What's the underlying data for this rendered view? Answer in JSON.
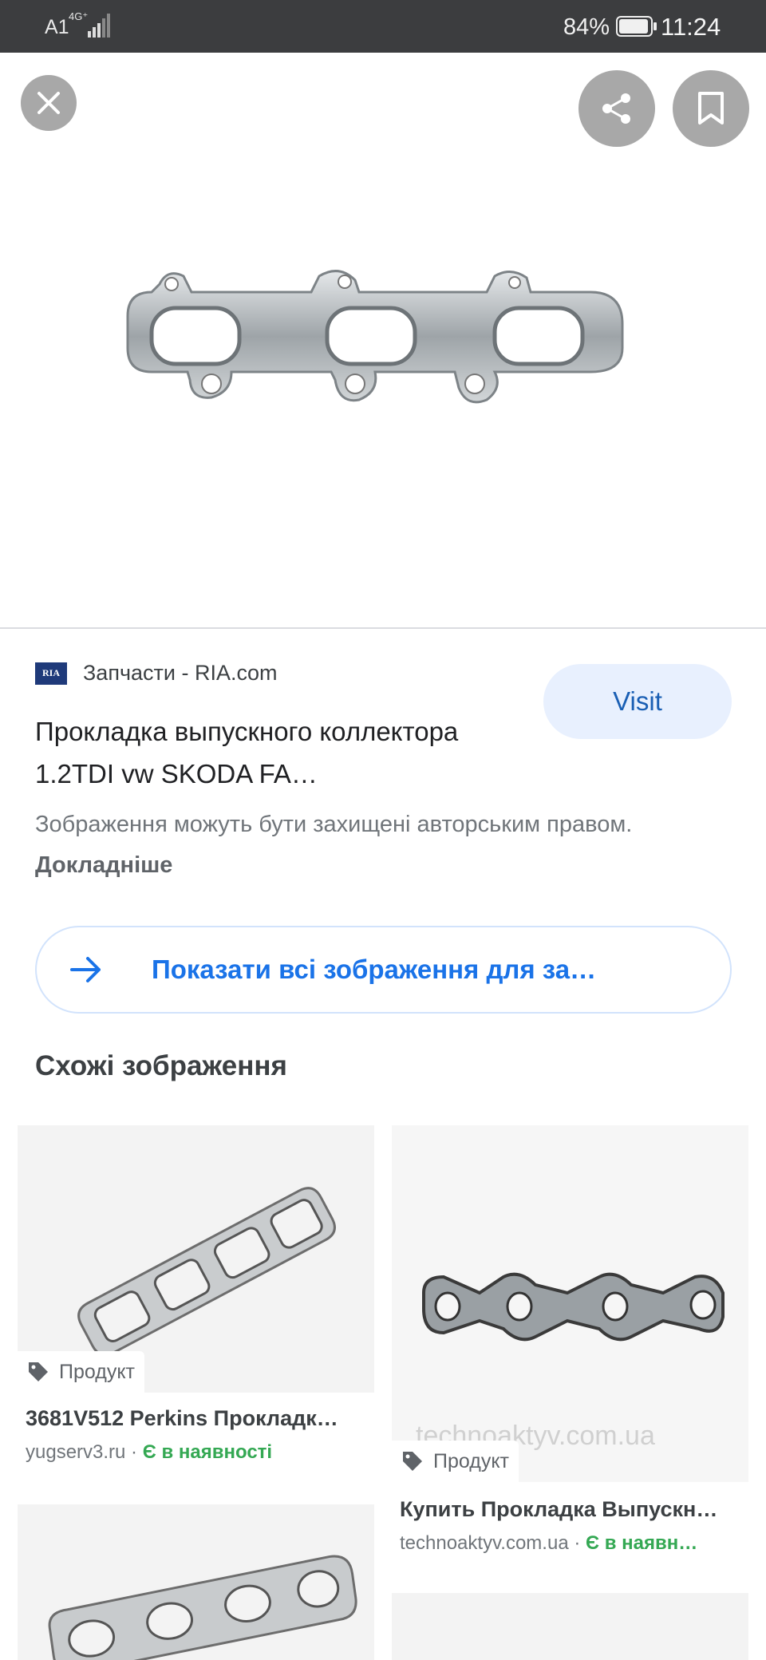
{
  "status_bar": {
    "carrier": "A1",
    "network": "4G⁺",
    "battery_percent": "84%",
    "time": "11:24"
  },
  "viewer": {
    "close_icon": "close-icon",
    "share_icon": "share-icon",
    "bookmark_icon": "bookmark-icon"
  },
  "result": {
    "favicon_text": "RIA",
    "source": "Запчасти - RIA.com",
    "title": "Прокладка выпускного коллектора 1.2TDI vw SKODA FA…",
    "visit_label": "Visit",
    "copyright_text": "Зображення можуть бути захищені авторським правом.",
    "learn_more": "Докладніше",
    "show_all_label": "Показати всі зображення для за…"
  },
  "related": {
    "section_title": "Схожі зображення",
    "cards": [
      {
        "badge": "Продукт",
        "title": "3681V512 Perkins Прокладк…",
        "domain": "yugserv3.ru",
        "separator": " · ",
        "stock": "Є в наявності"
      },
      {
        "badge": "Продукт",
        "title": "Купить Прокладка Выпускн…",
        "domain": "technoaktyv.com.ua",
        "separator": " · ",
        "stock": "Є в наявн…",
        "watermark": "technoaktyv.com.ua"
      }
    ]
  },
  "colors": {
    "accent_blue": "#1a73e8",
    "visit_bg": "#e8f0fe",
    "in_stock_green": "#34a853",
    "status_bar_bg": "#3c3d3f"
  }
}
